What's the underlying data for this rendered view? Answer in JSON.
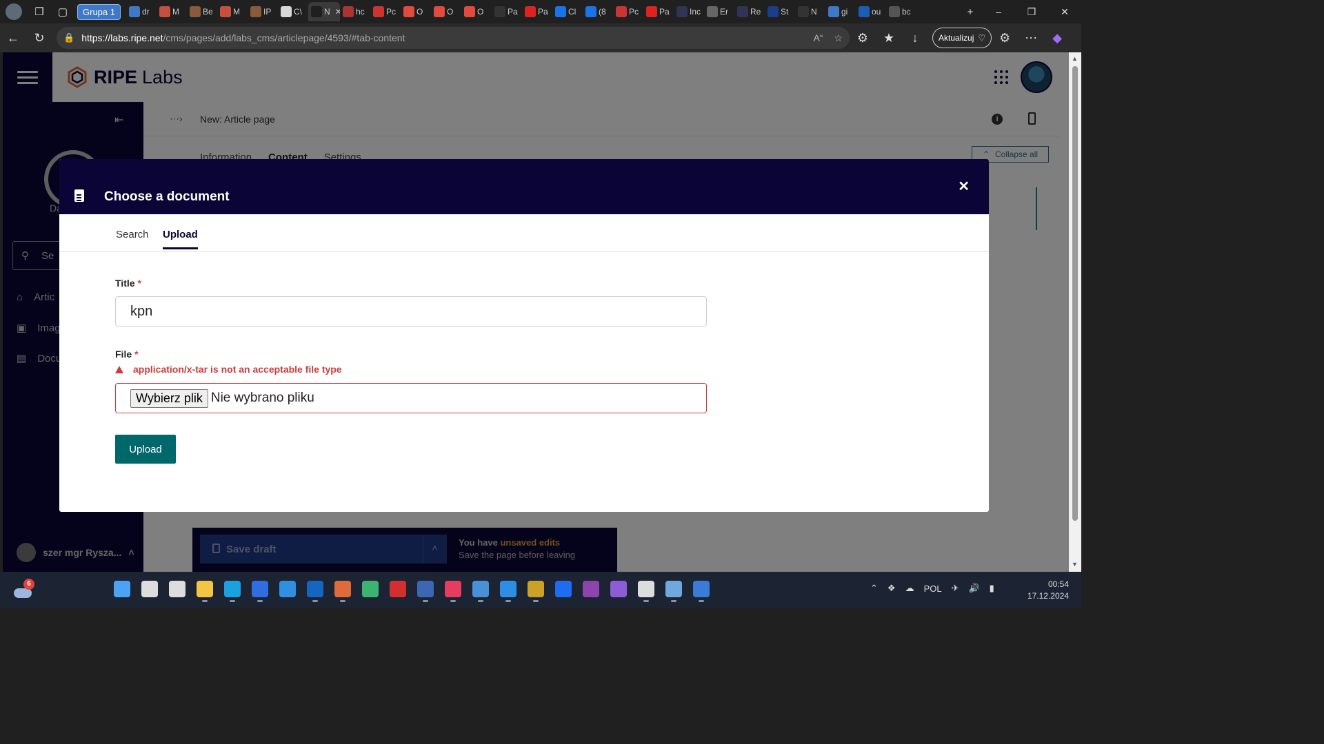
{
  "browser": {
    "tab_group_label": "Grupa 1",
    "tabs": [
      {
        "short": "dr",
        "icon": "search-icon",
        "color": "#3f78c7"
      },
      {
        "short": "M",
        "icon": "circle-icon",
        "color": "#c6503d"
      },
      {
        "short": "Be",
        "icon": "link-icon",
        "color": "#8a5a3c"
      },
      {
        "short": "M",
        "icon": "circle-icon",
        "color": "#c6503d"
      },
      {
        "short": "IP",
        "icon": "link-icon",
        "color": "#8a5a3c"
      },
      {
        "short": "C\\",
        "icon": "camera-icon",
        "color": "#d8d8d8"
      },
      {
        "short": "N",
        "icon": "ripe-icon",
        "color": "#1f1f1f",
        "active": true
      },
      {
        "short": "hc",
        "icon": "circle-icon",
        "color": "#a33"
      },
      {
        "short": "Pc",
        "icon": "pdf-icon",
        "color": "#c33"
      },
      {
        "short": "O",
        "icon": "gmail-icon",
        "color": "#e14b3b"
      },
      {
        "short": "O",
        "icon": "gmail-icon",
        "color": "#e14b3b"
      },
      {
        "short": "O",
        "icon": "gmail-icon",
        "color": "#e14b3b"
      },
      {
        "short": "Pa",
        "icon": "u-icon",
        "color": "#333"
      },
      {
        "short": "Pa",
        "icon": "e-icon",
        "color": "#d22"
      },
      {
        "short": "Cl",
        "icon": "at-icon",
        "color": "#1a73e8"
      },
      {
        "short": "(8",
        "icon": "mail-icon",
        "color": "#1a73e8"
      },
      {
        "short": "Pc",
        "icon": "pdf-icon",
        "color": "#c33"
      },
      {
        "short": "Pa",
        "icon": "e-icon",
        "color": "#d22"
      },
      {
        "short": "Inc",
        "icon": "inc-icon",
        "color": "#335"
      },
      {
        "short": "Er",
        "icon": "globe-icon",
        "color": "#666"
      },
      {
        "short": "Re",
        "icon": "inc-icon",
        "color": "#335"
      },
      {
        "short": "St",
        "icon": "eu-icon",
        "color": "#1a3e8a"
      },
      {
        "short": "N",
        "icon": "github-icon",
        "color": "#333"
      },
      {
        "short": "gi",
        "icon": "search-icon",
        "color": "#3f78c7"
      },
      {
        "short": "ou",
        "icon": "outlook-icon",
        "color": "#1a5fb4"
      },
      {
        "short": "bc",
        "icon": "doc-icon",
        "color": "#555"
      }
    ],
    "url_host": "https://labs.ripe.net",
    "url_path": "/cms/pages/add/labs_cms/articlepage/4593/#tab-content",
    "update_label": "Aktualizuj"
  },
  "cms": {
    "brand": "RIPE",
    "brand_suffix": "Labs",
    "sidebar": {
      "dashboard_label": "Da",
      "search_placeholder": "Se",
      "items": [
        "Artic",
        "Imag",
        "Docu"
      ],
      "user_name": "szer mgr Rysza..."
    },
    "page_title": "New: Article page",
    "tabs": [
      "Information",
      "Content",
      "Settings"
    ],
    "active_tab": "Content",
    "collapse_all_label": "Collapse all"
  },
  "modal": {
    "title": "Choose a document",
    "tabs": [
      "Search",
      "Upload"
    ],
    "active_tab": "Upload",
    "title_label": "Title",
    "title_value": "kpn",
    "file_label": "File",
    "required_mark": "*",
    "error_message": "application/x-tar is not an acceptable file type",
    "file_button_label": "Wybierz plik",
    "file_status": "Nie wybrano pliku",
    "upload_label": "Upload"
  },
  "footer": {
    "save_draft_label": "Save draft",
    "unsaved_prefix": "You have",
    "unsaved_highlight": "unsaved edits",
    "unsaved_note": "Save the page before leaving"
  },
  "taskbar": {
    "weather_badge": "6",
    "language": "POL",
    "time": "00:54",
    "date": "17.12.2024",
    "apps": [
      {
        "name": "start",
        "color": "#4ba3f5"
      },
      {
        "name": "search",
        "color": "#ddd"
      },
      {
        "name": "task-view",
        "color": "#ddd"
      },
      {
        "name": "file-explorer",
        "color": "#f4c542",
        "running": true
      },
      {
        "name": "edge",
        "color": "#1ba0e2",
        "running": true
      },
      {
        "name": "save-app",
        "color": "#2f6de0",
        "running": true
      },
      {
        "name": "store",
        "color": "#2f8fe0"
      },
      {
        "name": "outlook",
        "color": "#1566c0",
        "running": true
      },
      {
        "name": "git",
        "color": "#e06b3a",
        "running": true
      },
      {
        "name": "globe-app",
        "color": "#3cb371"
      },
      {
        "name": "opera-app",
        "color": "#d32f2f"
      },
      {
        "name": "virtualbox",
        "color": "#3b67b3",
        "running": true
      },
      {
        "name": "paint-app",
        "color": "#e63d5e",
        "running": true
      },
      {
        "name": "network-app",
        "color": "#4a90d9",
        "running": true
      },
      {
        "name": "vscode",
        "color": "#2c8fe3",
        "running": true
      },
      {
        "name": "server-app",
        "color": "#c9a227",
        "running": true
      },
      {
        "name": "dropbox",
        "color": "#1f6cf0"
      },
      {
        "name": "tor",
        "color": "#8e44ad"
      },
      {
        "name": "github-desktop",
        "color": "#8e5cd6"
      },
      {
        "name": "presentation-app",
        "color": "#ddd",
        "running": true
      },
      {
        "name": "photos-app",
        "color": "#6fa8dc",
        "running": true
      },
      {
        "name": "help-app",
        "color": "#3a7bd5",
        "running": true
      }
    ]
  }
}
